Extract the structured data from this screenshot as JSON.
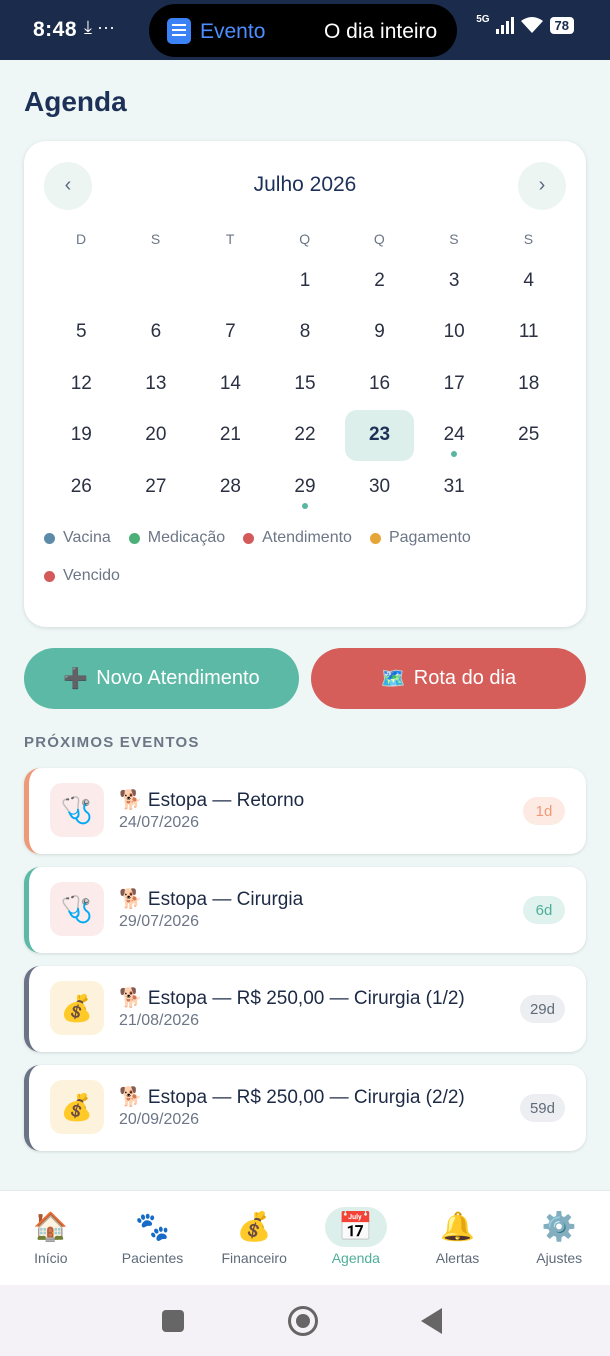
{
  "status_bar": {
    "time": "8:48",
    "left_icons": "⤓ ···",
    "live_event_label": "Evento",
    "live_event_detail": "O dia inteiro",
    "network": "5G",
    "battery": "78"
  },
  "page": {
    "title": "Agenda"
  },
  "calendar": {
    "month_label": "Julho 2026",
    "prev_label": "‹",
    "next_label": "›",
    "weekdays": [
      "D",
      "S",
      "T",
      "Q",
      "Q",
      "S",
      "S"
    ],
    "leading_blanks": 3,
    "days": [
      "1",
      "2",
      "3",
      "4",
      "5",
      "6",
      "7",
      "8",
      "9",
      "10",
      "11",
      "12",
      "13",
      "14",
      "15",
      "16",
      "17",
      "18",
      "19",
      "20",
      "21",
      "22",
      "23",
      "24",
      "25",
      "26",
      "27",
      "28",
      "29",
      "30",
      "31"
    ],
    "selected_day": "23",
    "event_days": [
      "24",
      "29"
    ],
    "legend": [
      {
        "label": "Vacina",
        "color": "#5d8aa8"
      },
      {
        "label": "Medicação",
        "color": "#4caf78"
      },
      {
        "label": "Atendimento",
        "color": "#d35a5a"
      },
      {
        "label": "Pagamento",
        "color": "#e5a637"
      },
      {
        "label": "Vencido",
        "color": "#d35a5a"
      }
    ]
  },
  "actions": {
    "new_appointment_icon": "➕",
    "new_appointment_label": "Novo Atendimento",
    "route_icon": "🗺️",
    "route_label": "Rota do dia"
  },
  "section": {
    "upcoming_label": "PRÓXIMOS EVENTOS"
  },
  "events": [
    {
      "icon": "🩺",
      "title": "🐕 Estopa — Retorno",
      "date": "24/07/2026",
      "badge": "1d",
      "accent": "#ee9a78",
      "icon_bg": "#fbeceb",
      "badge_bg": "#fdeae3",
      "badge_color": "#ee9a78"
    },
    {
      "icon": "🩺",
      "title": "🐕 Estopa — Cirurgia",
      "date": "29/07/2026",
      "badge": "6d",
      "accent": "#5bb9a6",
      "icon_bg": "#fbeceb",
      "badge_bg": "#dff2ee",
      "badge_color": "#4fae9a"
    },
    {
      "icon": "💰",
      "title": "🐕 Estopa — R$ 250,00 — Cirurgia (1/2)",
      "date": "21/08/2026",
      "badge": "29d",
      "accent": "#6b7386",
      "icon_bg": "#fdf3dc",
      "badge_bg": "#eceef1",
      "badge_color": "#5f6b7a"
    },
    {
      "icon": "💰",
      "title": "🐕 Estopa — R$ 250,00 — Cirurgia (2/2)",
      "date": "20/09/2026",
      "badge": "59d",
      "accent": "#6b7386",
      "icon_bg": "#fdf3dc",
      "badge_bg": "#eceef1",
      "badge_color": "#5f6b7a"
    }
  ],
  "bottom_nav": [
    {
      "id": "inicio",
      "icon": "🏠",
      "label": "Início",
      "active": false
    },
    {
      "id": "pacientes",
      "icon": "🐾",
      "label": "Pacientes",
      "active": false
    },
    {
      "id": "financeiro",
      "icon": "💰",
      "label": "Financeiro",
      "active": false
    },
    {
      "id": "agenda",
      "icon": "📅",
      "label": "Agenda",
      "active": true
    },
    {
      "id": "alertas",
      "icon": "🔔",
      "label": "Alertas",
      "active": false
    },
    {
      "id": "ajustes",
      "icon": "⚙️",
      "label": "Ajustes",
      "active": false
    }
  ]
}
